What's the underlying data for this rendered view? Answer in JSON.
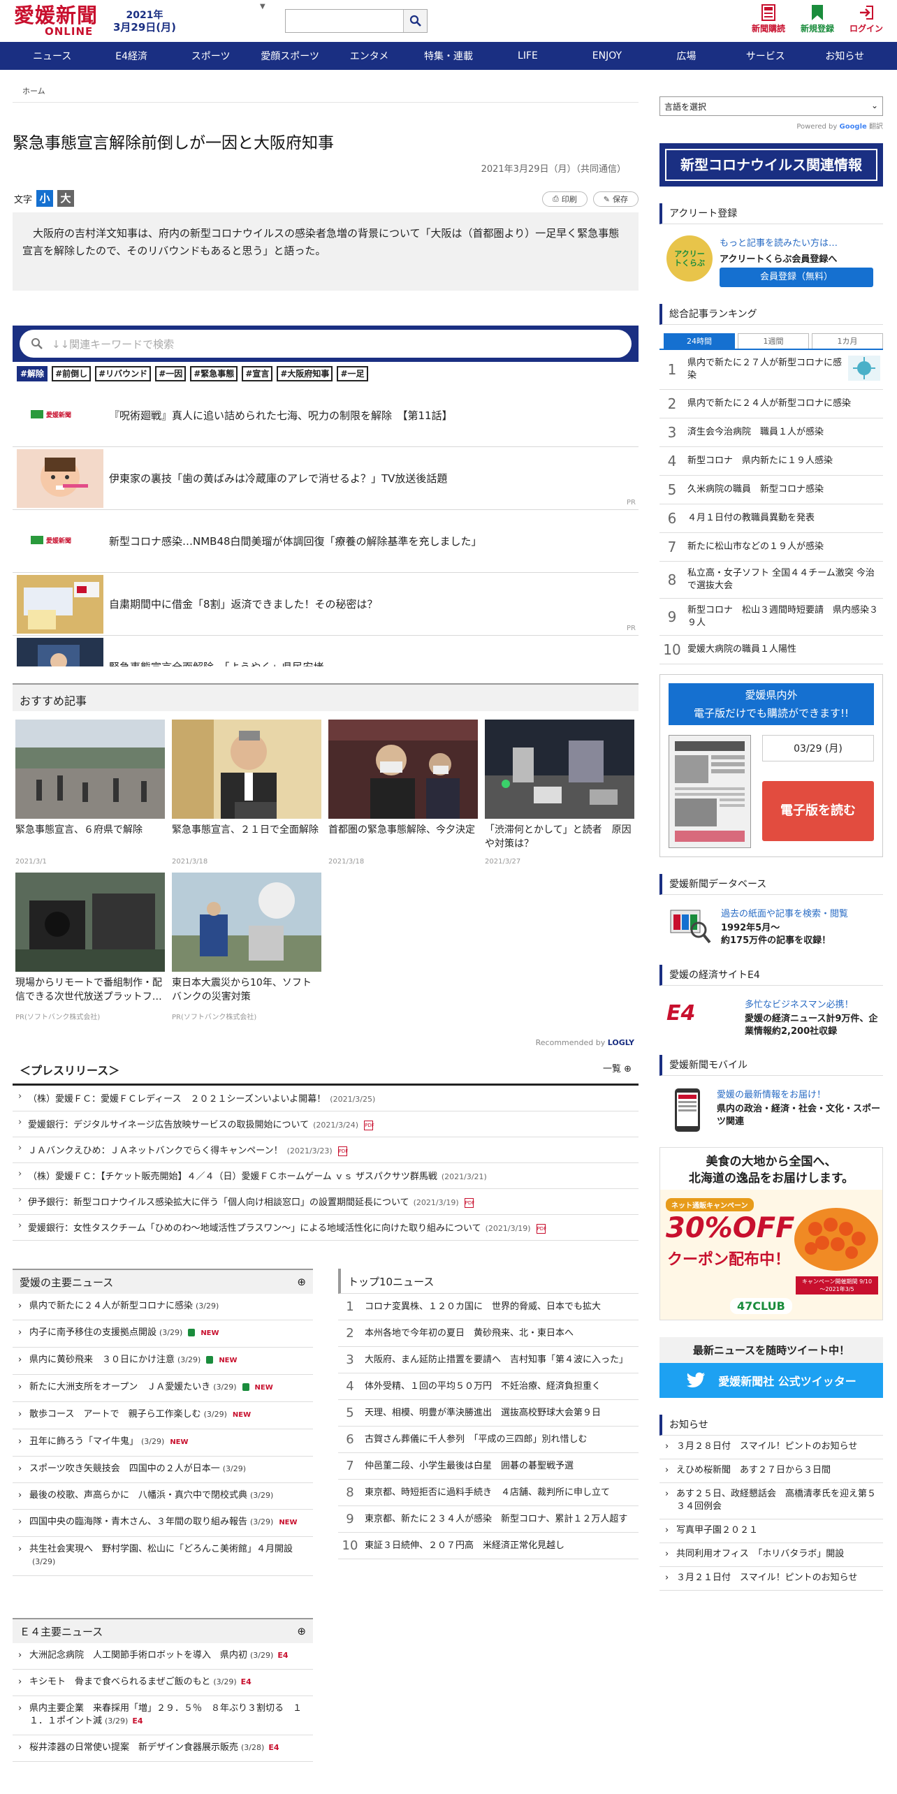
{
  "header": {
    "logo_main": "愛媛新聞",
    "logo_sub": "ONLINE",
    "year": "2021年",
    "date": "3月29日(月)",
    "subscribe": "新聞購読",
    "register": "新規登録",
    "login": "ログイン"
  },
  "nav": [
    "ニュース",
    "E4経済",
    "スポーツ",
    "愛顔スポーツ",
    "エンタメ",
    "特集・連載",
    "LIFE",
    "ENJOY",
    "広場",
    "サービス",
    "お知らせ"
  ],
  "breadcrumb": "ホーム",
  "article": {
    "title": "緊急事態宣言解除前倒しが一因と大阪府知事",
    "date": "2021年3月29日（月）（共同通信）",
    "font_label": "文字",
    "font_small": "小",
    "font_large": "大",
    "print": "印刷",
    "save": "保存",
    "lead": "大阪府の吉村洋文知事は、府内の新型コロナウイルスの感染者急増の背景について「大阪は（首都圏より）一足早く緊急事態宣言を解除したので、そのリバウンドもあると思う」と語った。"
  },
  "search_related": {
    "placeholder": "↓↓関連キーワードで検索",
    "tags": [
      "#解除",
      "#前倒し",
      "#リバウンド",
      "#一因",
      "#緊急事態",
      "#宣言",
      "#大阪府知事",
      "#一足"
    ]
  },
  "recommend_list": [
    {
      "text": "『呪術廻戦』真人に追い詰められた七海、呪力の制限を解除　【第11話】",
      "pr": ""
    },
    {
      "text": "伊東家の裏技「歯の黄ばみは冷蔵庫のアレで消せるよ？」TV放送後話題",
      "pr": "PR"
    },
    {
      "text": "新型コロナ感染…NMB48白間美瑠が体調回復「療養の解除基準を充しました」",
      "pr": ""
    },
    {
      "text": "自粛期間中に借金「8割」返済できました！その秘密は？",
      "pr": "PR"
    },
    {
      "text": "緊急事態宣言全面解除　「ようやく」県民安堵",
      "pr": ""
    }
  ],
  "osusume": {
    "title": "おすすめ記事",
    "logly": "Recommended by",
    "logly_brand": "LOGLY",
    "cards": [
      {
        "text": "緊急事態宣言、６府県で解除",
        "date": "2021/3/1"
      },
      {
        "text": "緊急事態宣言、２１日で全面解除",
        "date": "2021/3/18"
      },
      {
        "text": "首都圏の緊急事態解除、今夕決定",
        "date": "2021/3/18"
      },
      {
        "text": "「渋滞何とかして」と読者　原因や対策は？",
        "date": "2021/3/27"
      },
      {
        "text": "現場からリモートで番組制作・配信できる次世代放送プラットフ…",
        "date": "PR(ソフトバンク株式会社)"
      },
      {
        "text": "東日本大震災から10年、ソフトバンクの災害対策",
        "date": "PR(ソフトバンク株式会社)"
      }
    ]
  },
  "press": {
    "title": "＜プレスリリース＞",
    "more": "一覧",
    "items": [
      {
        "text": "（株）愛媛ＦＣ：愛媛ＦＣレディース　２０２１シーズンいよいよ開幕！",
        "date": "(2021/3/25)",
        "pdf": false
      },
      {
        "text": "愛媛銀行：デジタルサイネージ広告放映サービスの取扱開始について",
        "date": "(2021/3/24)",
        "pdf": true
      },
      {
        "text": "ＪＡバンクえひめ：ＪＡネットバンクでらく得キャンペーン！",
        "date": "(2021/3/23)",
        "pdf": true
      },
      {
        "text": "（株）愛媛ＦＣ：【チケット販売開始】４／４（日）愛媛ＦＣホームゲーム ｖｓ ザスパクサツ群馬戦",
        "date": "(2021/3/21)",
        "pdf": false
      },
      {
        "text": "伊予銀行：新型コロナウイルス感染拡大に伴う「個人向け相談窓口」の設置期間延長について",
        "date": "(2021/3/19)",
        "pdf": true
      },
      {
        "text": "愛媛銀行：女性タスクチーム「ひめのわ～地域活性プラスワン～」による地域活性化に向けた取り組みについて",
        "date": "(2021/3/19)",
        "pdf": true
      }
    ]
  },
  "ehime_news": {
    "title": "愛媛の主要ニュース",
    "items": [
      {
        "text": "県内で新たに２４人が新型コロナに感染",
        "date": "(3/29)",
        "lock": false,
        "new": false
      },
      {
        "text": "内子に南予移住の支援拠点開設",
        "date": "(3/29)",
        "lock": true,
        "new": true
      },
      {
        "text": "県内に黄砂飛来　３０日にかけ注意",
        "date": "(3/29)",
        "lock": true,
        "new": true
      },
      {
        "text": "新たに大洲支所をオープン　ＪＡ愛媛たいき",
        "date": "(3/29)",
        "lock": true,
        "new": true
      },
      {
        "text": "散歩コース　アートで　親子ら工作楽しむ",
        "date": "(3/29)",
        "lock": false,
        "new": true
      },
      {
        "text": "丑年に飾ろう「マイ牛鬼」",
        "date": "(3/29)",
        "lock": false,
        "new": true
      },
      {
        "text": "スポーツ吹き矢競技会　四国中の２人が日本一",
        "date": "(3/29)",
        "lock": false,
        "new": false
      },
      {
        "text": "最後の校歌、声高らかに　八幡浜・真穴中で閉校式典",
        "date": "(3/29)",
        "lock": false,
        "new": false
      },
      {
        "text": "四国中央の臨海隊・青木さん、３年間の取り組み報告",
        "date": "(3/29)",
        "lock": false,
        "new": true
      },
      {
        "text": "共生社会実現へ　野村学園、松山に「どろんこ美術館」４月開設",
        "date": "(3/29)",
        "lock": false,
        "new": false
      }
    ]
  },
  "top10": {
    "title": "トップ10ニュース",
    "items": [
      "コロナ変異株、１２０カ国に　世界的脅威、日本でも拡大",
      "本州各地で今年初の夏日　黄砂飛来、北・東日本へ",
      "大阪府、まん延防止措置を要請へ　吉村知事「第４波に入った」",
      "体外受精、１回の平均５０万円　不妊治療、経済負担重く",
      "天理、相模、明豊が準決勝進出　選抜高校野球大会第９日",
      "古賀さん葬儀に千人参列　「平成の三四郎」別れ惜しむ",
      "仲邑菫二段、小学生最後は白星　囲碁の碁聖戦予選",
      "東京都、時短拒否に過料手続き　４店舗、裁判所に申し立て",
      "東京都、新たに２３４人が感染　新型コロナ、累計１２万人超す",
      "東証３日続伸、２０７円高　米経済正常化見越し"
    ]
  },
  "e4news": {
    "title": "Ｅ４主要ニュース",
    "e4": "E4",
    "items": [
      {
        "text": "大洲記念病院　人工関節手術ロボットを導入　県内初",
        "date": "(3/29)"
      },
      {
        "text": "キシモト　骨まで食べられるまぜご飯のもと",
        "date": "(3/29)"
      },
      {
        "text": "県内主要企業　来春採用「増」２９．５％　８年ぶり３割切る　１１．１ポイント減",
        "date": "(3/29)"
      },
      {
        "text": "桜井漆器の日常使い提案　新デザイン食器展示販売",
        "date": "(3/28)"
      }
    ]
  },
  "sidebar": {
    "lang": "言語を選択",
    "powered": "Powered by",
    "google": "Google",
    "translate": "翻訳",
    "corona": "新型コロナウイルス関連情報",
    "aclub_h": "アクリート登録",
    "aclub_logo": "アクリートくらぶ",
    "aclub_t1": "もっと記事を読みたい方は…",
    "aclub_t2": "アクリートくらぶ会員登録へ",
    "aclub_btn": "会員登録（無料）",
    "ranking_h": "総合記事ランキング",
    "tabs": [
      "24時間",
      "1週間",
      "1カ月"
    ],
    "ranking": [
      "県内で新たに２７人が新型コロナに感染",
      "県内で新たに２４人が新型コロナに感染",
      "済生会今治病院　職員１人が感染",
      "新型コロナ　県内新たに１９人感染",
      "久米病院の職員　新型コロナ感染",
      "４月１日付の教職員異動を発表",
      "新たに松山市などの１９人が感染",
      "私立高・女子ソフト 全国４４チーム激突 今治で選抜大会",
      "新型コロナ　松山３週間時短要請　県内感染３９人",
      "愛媛大病院の職員１人陽性"
    ],
    "epaper_h1": "愛媛県内外",
    "epaper_h2": "電子版だけでも購読ができます!!",
    "epaper_date": "03/29 (月)",
    "epaper_btn": "電子版を読む",
    "db_h": "愛媛新聞データベース",
    "db_t1": "過去の紙面や記事を検索・閲覧",
    "db_t2": "1992年5月～",
    "db_t3": "約175万件の記事を収録！",
    "e4_h": "愛媛の経済サイトE4",
    "e4_logo": "E4",
    "e4_t1": "多忙なビジネスマン必携！",
    "e4_t2": "愛媛の経済ニュース計9万件、企業情報約2,200社収録",
    "mobile_h": "愛媛新聞モバイル",
    "mobile_t1": "愛媛の最新情報をお届け！",
    "mobile_t2": "県内の政治・経済・社会・文化・スポーツ関連",
    "ad_t1": "美食の大地から全国へ、",
    "ad_t2": "北海道の逸品をお届けします。",
    "ad_camp": "ネット通販キャンペーン",
    "ad_off": "30%OFF",
    "ad_coupon": "クーポン配布中！",
    "ad_period": "キャンペーン開催期間 9/10～2021年3/5",
    "ad_brand": "47CLUB",
    "twitter_h": "最新ニュースを随時ツイート中！",
    "twitter": "愛媛新聞社 公式ツイッター",
    "info_h": "お知らせ",
    "info": [
      "３月２８日付　スマイル！ピントのお知らせ",
      "えひめ桜新聞　あす２７日から３日間",
      "あす２５日、政経懇話会　高橋清孝氏を迎え第５３４回例会",
      "写真甲子園２０２１",
      "共同利用オフィス　「ホリバタラボ」開設",
      "３月２１日付　スマイル！ピントのお知らせ"
    ]
  },
  "colors": {
    "navy": "#1a2f82",
    "red": "#c8102e",
    "blue": "#1570d0",
    "twitter": "#1da1f2"
  }
}
